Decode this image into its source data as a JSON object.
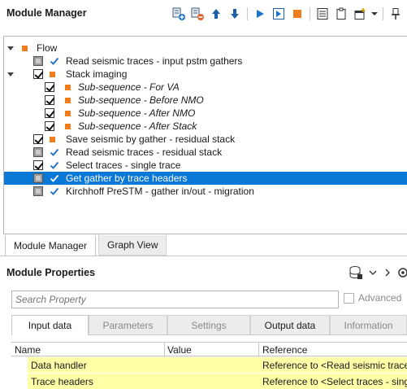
{
  "module_manager": {
    "title": "Module Manager",
    "toolbar_icons": [
      "add-module-icon",
      "remove-module-icon",
      "move-up-icon",
      "move-down-icon",
      "run-icon",
      "run-step-icon",
      "stop-icon",
      "list-icon",
      "clipboard-icon",
      "new-window-icon",
      "dropdown-icon",
      "pin-icon"
    ],
    "tree": [
      {
        "label": "Flow",
        "italic": false,
        "type": "root"
      },
      {
        "label": "Read seismic traces - input pstm gathers",
        "italic": false
      },
      {
        "label": "Stack imaging",
        "italic": false
      },
      {
        "label": "Sub-sequence - For VA",
        "italic": true
      },
      {
        "label": "Sub-sequence - Before NMO",
        "italic": true
      },
      {
        "label": "Sub-sequence - After NMO",
        "italic": true
      },
      {
        "label": "Sub-sequence - After Stack",
        "italic": true
      },
      {
        "label": "Save seismic by gather - residual stack",
        "italic": false
      },
      {
        "label": "Read seismic traces - residual stack",
        "italic": false
      },
      {
        "label": "Select traces - single trace",
        "italic": false
      },
      {
        "label": "Get gather by trace headers",
        "italic": false,
        "selected": true
      },
      {
        "label": "Kirchhoff PreSTM - gather in/out - migration",
        "italic": false
      }
    ],
    "view_tabs": [
      {
        "label": "Module Manager",
        "active": true
      },
      {
        "label": "Graph View",
        "active": false
      }
    ]
  },
  "module_properties": {
    "title": "Module Properties",
    "search_placeholder": "Search Property",
    "advanced_label": "Advanced",
    "tabs": [
      {
        "label": "Input data",
        "active": true
      },
      {
        "label": "Parameters"
      },
      {
        "label": "Settings"
      },
      {
        "label": "Output data"
      },
      {
        "label": "Information"
      }
    ],
    "grid": {
      "columns": [
        "Name",
        "Value",
        "Reference"
      ],
      "rows": [
        {
          "name": "Data handler",
          "value": "",
          "reference": "Reference to <Read seismic traces"
        },
        {
          "name": "Trace headers",
          "value": "",
          "reference": "Reference to <Select traces - singl"
        }
      ]
    }
  },
  "colors": {
    "accent": "#0a78d7",
    "orange": "#f07d1e",
    "highlight_row": "#ffffa8",
    "check_blue": "#1f6fc5"
  }
}
